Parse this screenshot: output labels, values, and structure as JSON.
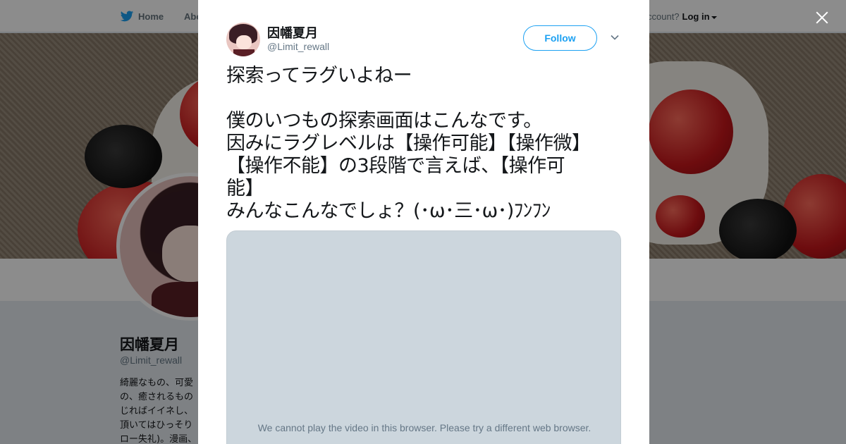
{
  "nav": {
    "home_label": "Home",
    "about_label": "Abo",
    "account_prompt": "ccount?",
    "login_label": "Log in"
  },
  "profile": {
    "name": "因幡夏月",
    "handle": "@Limit_rewall",
    "bio_lines": [
      "綺麗なもの、可愛",
      "の、癒されるもの",
      "じればイイネし、",
      "頂いてはひっそり",
      "ロー失礼)。漫画、"
    ]
  },
  "tweet": {
    "author_name": "因幡夏月",
    "author_handle": "@Limit_rewall",
    "follow_label": "Follow",
    "text": "探索ってラグいよねー\n\n僕のいつもの探索画面はこんなです。\n因みにラグレベルは【操作可能】【操作微】\n【操作不能】の3段階で言えば、【操作可\n能】\nみんなこんなでしょ？(･ω･三･ω･)ﾌﾝﾌﾝ",
    "video_message": "We cannot play the video in this browser. Please try a different web browser."
  },
  "colors": {
    "brand_blue": "#1da1f2",
    "text_dark": "#14171a",
    "text_muted": "#657786",
    "video_placeholder": "#ccd6dd"
  },
  "icons": {
    "nav_logo": "twitter-bird-icon",
    "close": "close-icon",
    "tweet_menu": "chevron-down-icon"
  }
}
